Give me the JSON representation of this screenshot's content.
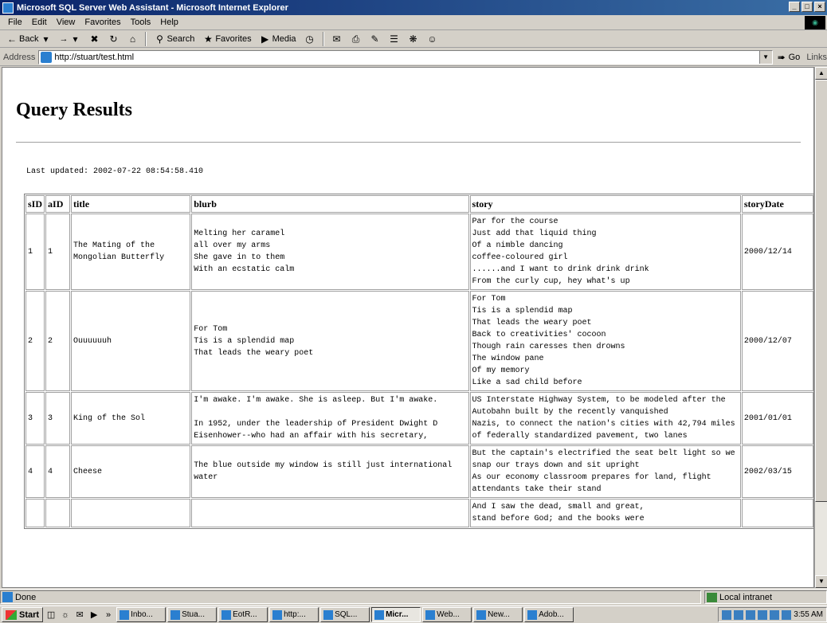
{
  "window": {
    "title": "Microsoft SQL Server Web Assistant - Microsoft Internet Explorer",
    "controls": [
      "_",
      "□",
      "×"
    ]
  },
  "menu": [
    "File",
    "Edit",
    "View",
    "Favorites",
    "Tools",
    "Help"
  ],
  "toolbar": {
    "back": "Back",
    "forward": "→",
    "search": "Search",
    "favorites": "Favorites",
    "media": "Media"
  },
  "address": {
    "label": "Address",
    "url": "http://stuart/test.html",
    "go": "Go",
    "links": "Links"
  },
  "page": {
    "heading": "Query Results",
    "last_updated": "Last updated: 2002-07-22 08:54:58.410"
  },
  "table": {
    "headers": [
      "sID",
      "aID",
      "title",
      "blurb",
      "story",
      "storyDate"
    ],
    "rows": [
      {
        "sid": "1",
        "aid": "1",
        "title": "The Mating of the Mongolian Butterfly",
        "blurb": "Melting her caramel\nall over my arms\nShe gave in to them\nWith an ecstatic calm",
        "story": "Par for the course\nJust add that liquid thing\nOf a nimble dancing\ncoffee-coloured girl\n......and I want to drink drink drink\nFrom the curly cup, hey what's up",
        "date": "2000/12/14"
      },
      {
        "sid": "2",
        "aid": "2",
        "title": "Ouuuuuuh",
        "blurb": "For Tom\nTis is a splendid map\nThat leads the weary poet",
        "story": "For Tom\nTis is a splendid map\nThat leads the weary poet\nBack to creativities' cocoon\nThough rain caresses then drowns\nThe window pane\nOf my memory\nLike a sad child before",
        "date": "2000/12/07"
      },
      {
        "sid": "3",
        "aid": "3",
        "title": "King of the Sol",
        "blurb": "I'm awake. I'm awake. She is asleep. But I'm awake.\n\nIn 1952, under the leadership of President Dwight D Eisenhower--who had an affair with his secretary,",
        "story": "US Interstate Highway System, to be modeled after the Autobahn built by the recently vanquished\nNazis, to connect the nation's cities with 42,794 miles of federally standardized pavement, two lanes",
        "date": "2001/01/01"
      },
      {
        "sid": "4",
        "aid": "4",
        "title": "Cheese",
        "blurb": "The blue outside my window is still just international water",
        "story": "But the captain's electrified the seat belt light so we snap our trays down and sit upright\nAs our economy classroom prepares for land, flight attendants take their stand",
        "date": "2002/03/15"
      },
      {
        "sid": "",
        "aid": "",
        "title": "",
        "blurb": "",
        "story": "And I saw the dead, small and great,\nstand before God; and the books were",
        "date": ""
      }
    ]
  },
  "status": {
    "text": "Done",
    "zone": "Local intranet"
  },
  "taskbar": {
    "start": "Start",
    "tasks": [
      "Inbo...",
      "Stua...",
      "EotR...",
      "http:...",
      "SQL...",
      "Micr...",
      "Web...",
      "New...",
      "Adob..."
    ],
    "active_index": 5,
    "clock": "3:55 AM"
  }
}
